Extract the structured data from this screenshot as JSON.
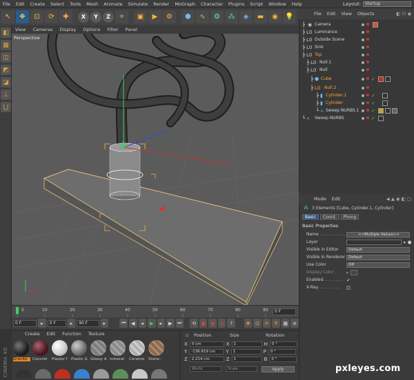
{
  "menubar": {
    "items": [
      "File",
      "Edit",
      "Create",
      "Select",
      "Tools",
      "Mesh",
      "Animate",
      "Simulate",
      "Render",
      "MoGraph",
      "Character",
      "Plugins",
      "Script",
      "Window",
      "Help"
    ],
    "layout_label": "Layout:",
    "layout_value": "Startup"
  },
  "toolbar": {
    "axis_x": "X",
    "axis_y": "Y",
    "axis_z": "Z"
  },
  "viewport": {
    "menu": [
      "View",
      "Cameras",
      "Display",
      "Options",
      "Filter",
      "Panel"
    ],
    "label": "Perspective"
  },
  "timeline": {
    "ticks": [
      "0",
      "10",
      "20",
      "30",
      "40",
      "50",
      "60",
      "70",
      "80",
      "90"
    ],
    "end_field": "0 F"
  },
  "transport": {
    "current": "0 F",
    "start": "0 F",
    "end": "90 F"
  },
  "materials": {
    "menu": [
      "Create",
      "Edit",
      "Function",
      "Texture"
    ],
    "items": [
      {
        "name": "Granite",
        "color": "#2c2c2c"
      },
      {
        "name": "Concret",
        "color": "#5a2a30"
      },
      {
        "name": "Plaster f",
        "color": "#d9d9d9"
      },
      {
        "name": "Plastic G",
        "color": "#6e6e6e"
      },
      {
        "name": "Glossy A",
        "color": "#7c7c7c"
      },
      {
        "name": "mineral",
        "color": "#8a8a8a"
      },
      {
        "name": "Ceramic",
        "color": "#b0b0b0"
      },
      {
        "name": "Stone -",
        "color": "#8c6a50"
      }
    ]
  },
  "side_label": "CINEMA 4D",
  "coordinates": {
    "headers": [
      "Position",
      "Size",
      "Rotation"
    ],
    "rows": [
      {
        "axis": "X",
        "pos": "0 cm",
        "size_axis": "X",
        "size": "1",
        "rot_axis": "H",
        "rot": "0 °"
      },
      {
        "axis": "Y",
        "pos": "-136.619 cm",
        "size_axis": "Y",
        "size": "1",
        "rot_axis": "P",
        "rot": "0 °"
      },
      {
        "axis": "Z",
        "pos": "2.214 cm",
        "size_axis": "Z",
        "size": "1",
        "rot_axis": "B",
        "rot": "0 °"
      }
    ],
    "mode1": "World",
    "mode2": "Scale",
    "apply": "Apply"
  },
  "objects": {
    "menu": [
      "File",
      "Edit",
      "View",
      "Objects"
    ],
    "items": [
      {
        "name": "Camera",
        "indent": 0,
        "orange": false
      },
      {
        "name": "Luminance",
        "indent": 0,
        "orange": false
      },
      {
        "name": "Outside Scene",
        "indent": 0,
        "orange": false
      },
      {
        "name": "Sink",
        "indent": 0,
        "orange": false
      },
      {
        "name": "Top",
        "indent": 0,
        "orange": true
      },
      {
        "name": "Null.1",
        "indent": 1,
        "orange": false
      },
      {
        "name": "Null",
        "indent": 1,
        "orange": false
      },
      {
        "name": "Cube",
        "indent": 2,
        "orange": true
      },
      {
        "name": "Null.2",
        "indent": 2,
        "orange": true
      },
      {
        "name": "Cylinder.1",
        "indent": 3,
        "orange": true
      },
      {
        "name": "Cylinder",
        "indent": 3,
        "orange": true
      },
      {
        "name": "Sweep NURBS.1",
        "indent": 3,
        "orange": false
      },
      {
        "name": "Sweep NURBS",
        "indent": 0,
        "orange": false
      }
    ]
  },
  "attributes": {
    "menu": [
      "Mode",
      "Edit"
    ],
    "title": "3 Elements [Cube, Cylinder.1, Cylinder]",
    "tabs": [
      "Basic",
      "Coord.",
      "Phong"
    ],
    "section": "Basic Properties",
    "rows": [
      {
        "label": "Name . . . . . . . . . . . .",
        "value": "<<Multiple Values>>"
      },
      {
        "label": "Layer",
        "value": ""
      },
      {
        "label": "Visible in Editor",
        "value": "Default"
      },
      {
        "label": "Visible in Renderer",
        "value": "Default"
      },
      {
        "label": "Use Color",
        "value": "Off"
      },
      {
        "label": "Display Color . .",
        "value": ""
      },
      {
        "label": "Enabled. . . . . . . .",
        "value": "✓"
      },
      {
        "label": "X-Ray . . . . . . . .",
        "value": ""
      }
    ]
  },
  "watermark": "pxleyes.com"
}
